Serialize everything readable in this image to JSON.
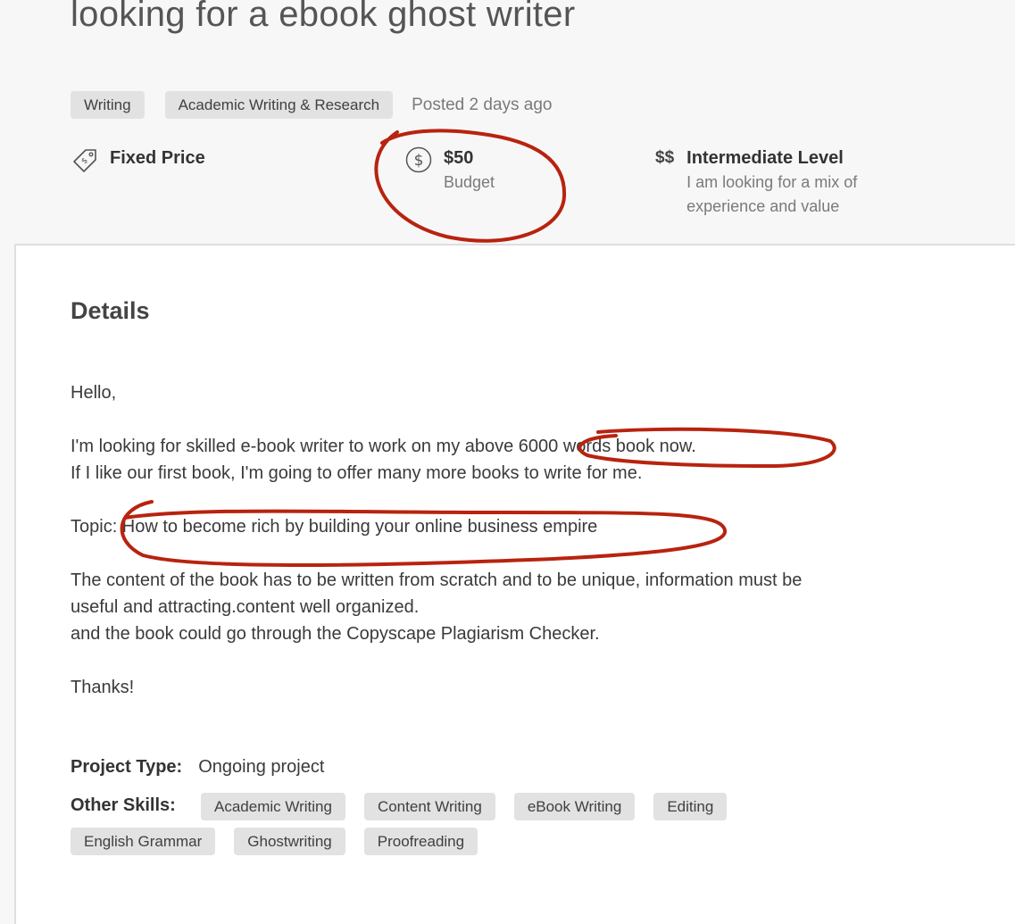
{
  "job": {
    "title": "looking for a ebook ghost writer",
    "tags": [
      "Writing",
      "Academic Writing & Research"
    ],
    "posted": "Posted 2 days ago"
  },
  "meta": {
    "price_type": "Fixed Price",
    "budget_amount": "$50",
    "budget_label": "Budget",
    "level_symbol": "$$",
    "level_title": "Intermediate Level",
    "level_desc_line1": "I am looking for a mix of",
    "level_desc_line2": "experience and value"
  },
  "details": {
    "heading": "Details",
    "greeting": "Hello,",
    "line1": "I'm looking for skilled e-book writer to work on my above 6000 words book now.",
    "line2": "If I like our first book, I'm going to offer many more books to write for me.",
    "topic": "Topic: How to become rich by building your online business empire",
    "content1": "The content of the book has to be written from scratch and to be unique, information must be",
    "content2": "useful and attracting.content well organized.",
    "content3": "and the book could go through the Copyscape Plagiarism Checker.",
    "thanks": "Thanks!"
  },
  "project": {
    "type_label": "Project Type:",
    "type_value": "Ongoing project",
    "skills_label": "Other Skills:",
    "skills": [
      "Academic Writing",
      "Content Writing",
      "eBook Writing",
      "Editing",
      "English Grammar",
      "Ghostwriting",
      "Proofreading"
    ]
  },
  "colors": {
    "annotation": "#b8230f",
    "tag_bg": "#e2e2e2",
    "page_bg": "#f7f7f7"
  },
  "icons": {
    "price": "price-tag-icon",
    "budget": "dollar-circle-icon"
  }
}
